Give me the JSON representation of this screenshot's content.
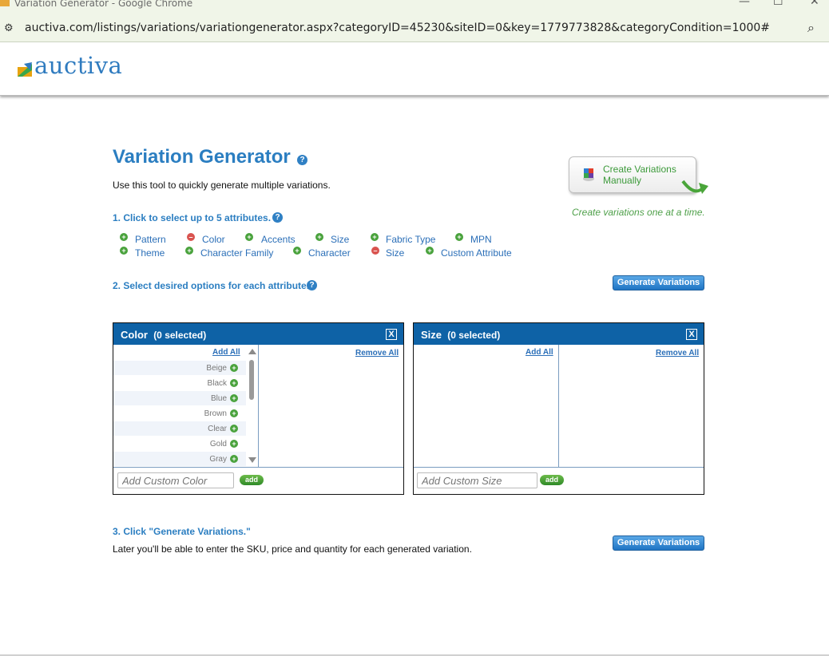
{
  "window": {
    "title": "Variation Generator - Google Chrome",
    "controls": [
      "—",
      "☐",
      "✕"
    ]
  },
  "address_bar": {
    "url": "auctiva.com/listings/variations/variationgenerator.aspx?categoryID=45230&siteID=0&key=1779773828&categoryCondition=1000#"
  },
  "site": {
    "logo_text": "auctiva"
  },
  "page": {
    "title": "Variation Generator",
    "intro": "Use this tool to quickly generate multiple variations.",
    "create_button": "Create Variations Manually",
    "create_note": "Create variations one at a time.",
    "step1": "1. Click to select up to 5 attributes.",
    "step2": "2. Select desired options for each attribute.",
    "step3": "3. Click \"Generate Variations.\"",
    "step3_note": "Later you'll be able to enter the SKU, price and quantity for each generated variation.",
    "generate_label": "Generate Variations",
    "help_glyph": "?"
  },
  "attributes": {
    "row1": [
      {
        "label": "Pattern",
        "state": "add"
      },
      {
        "label": "Color",
        "state": "remove"
      },
      {
        "label": "Accents",
        "state": "add"
      },
      {
        "label": "Size",
        "state": "add"
      },
      {
        "label": "Fabric Type",
        "state": "add"
      },
      {
        "label": "MPN",
        "state": "add"
      }
    ],
    "row2": [
      {
        "label": "Theme",
        "state": "add"
      },
      {
        "label": "Character Family",
        "state": "add"
      },
      {
        "label": "Character",
        "state": "add"
      },
      {
        "label": "Size",
        "state": "remove"
      },
      {
        "label": "Custom Attribute",
        "state": "add"
      }
    ]
  },
  "panels": {
    "color": {
      "title": "Color",
      "count": "(0 selected)",
      "close": "X",
      "add_all": "Add All",
      "remove_all": "Remove All",
      "options": [
        "Beige",
        "Black",
        "Blue",
        "Brown",
        "Clear",
        "Gold",
        "Gray"
      ],
      "custom_placeholder": "Add Custom Color",
      "add_label": "add"
    },
    "size": {
      "title": "Size",
      "count": "(0 selected)",
      "close": "X",
      "add_all": "Add All",
      "remove_all": "Remove All",
      "custom_placeholder": "Add Custom Size",
      "add_label": "add"
    }
  },
  "colors": {
    "brand_blue": "#2b7ec1",
    "panel_header": "#0e62a6",
    "add_green": "#49a23c",
    "remove_red": "#d9534f"
  }
}
